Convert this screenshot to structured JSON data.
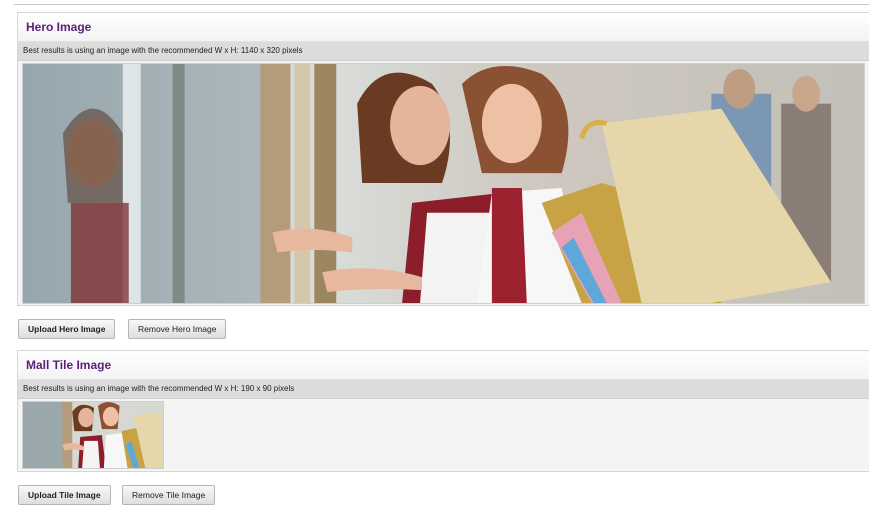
{
  "hero": {
    "title": "Hero Image",
    "hint": "Best results is using an image with the recommended W x H: 1140 x 320 pixels",
    "upload_label": "Upload Hero Image",
    "remove_label": "Remove Hero Image"
  },
  "tile": {
    "title": "Mall Tile Image",
    "hint": "Best results is using an image with the recommended W x H: 190 x 90 pixels",
    "upload_label": "Upload Tile Image",
    "remove_label": "Remove Tile Image"
  },
  "colors": {
    "title_purple": "#5b1e7a",
    "panel_bg": "#f4f4f4",
    "hint_bar": "#dcdcdc"
  }
}
